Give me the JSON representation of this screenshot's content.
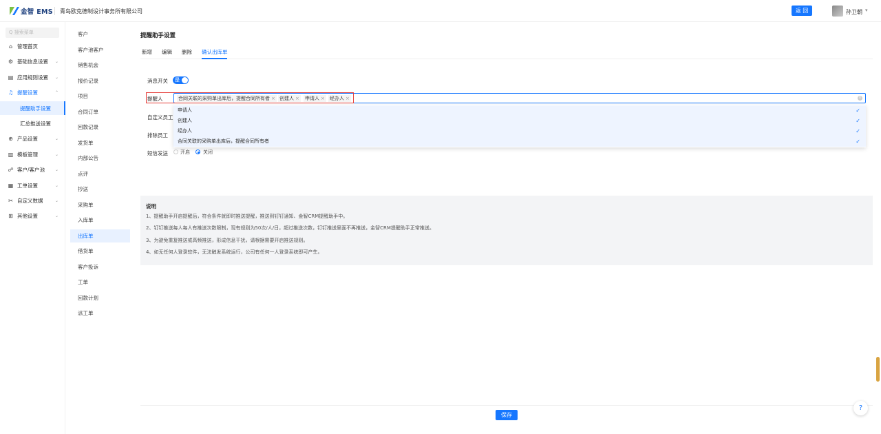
{
  "header": {
    "logo_text": "金智 EMS",
    "company": "青岛欧克德制设计事务所有限公司",
    "back_label": "返 回",
    "user_name": "孙卫朝",
    "user_caret": "▾"
  },
  "sidebar": {
    "search_placeholder": "Q 搜索菜单",
    "items": [
      {
        "icon": "⌂",
        "label": "管理首页"
      },
      {
        "icon": "⚙",
        "label": "基础信息设置",
        "chevron": "⌄"
      },
      {
        "icon": "▤",
        "label": "应用规则设置",
        "chevron": "⌄"
      },
      {
        "icon": "♫",
        "label": "提醒设置",
        "chevron": "⌃"
      },
      {
        "icon": "⊕",
        "label": "产品设置",
        "chevron": "⌄"
      },
      {
        "icon": "▥",
        "label": "模板管理",
        "chevron": "⌄"
      },
      {
        "icon": "☍",
        "label": "客户/客户池",
        "chevron": "⌄"
      },
      {
        "icon": "▦",
        "label": "工单设置",
        "chevron": "⌄"
      },
      {
        "icon": "✂",
        "label": "自定义数据",
        "chevron": "⌄"
      },
      {
        "icon": "⊞",
        "label": "其他设置",
        "chevron": "⌄"
      }
    ],
    "sub_items": [
      {
        "label": "提醒助手设置"
      },
      {
        "label": "汇总推送设置"
      }
    ]
  },
  "modules": [
    "客户",
    "客户池客户",
    "销售机会",
    "报价记录",
    "项目",
    "合同订单",
    "回款记录",
    "发货单",
    "内部公告",
    "点评",
    "抄送",
    "采购单",
    "入库单",
    "出库单",
    "借货单",
    "客户投诉",
    "工单",
    "回款计划",
    "派工单"
  ],
  "main": {
    "title": "提醒助手设置",
    "tabs": [
      "新增",
      "编辑",
      "删除",
      "确认出库单"
    ],
    "form": {
      "switch_label": "消息开关",
      "switch_text": "是",
      "reminder_label": "提醒人",
      "custom_label": "自定义员工",
      "exclude_label": "排除员工",
      "sms_label": "短信发送",
      "tags": [
        "合同关联的采购单出库后，提醒合同所有者",
        "创建人",
        "申请人",
        "经办人"
      ],
      "tag_remove": "×",
      "clear_icon": "×",
      "options": [
        "申请人",
        "创建人",
        "经办人",
        "合同关联的采购单出库后，提醒合同所有者"
      ],
      "check": "✓",
      "sms_on": "开启",
      "sms_off": "关闭"
    },
    "note": {
      "title": "说明",
      "lines": [
        "1、提醒助手开启提醒后，符合条件就即时推送提醒，推送到钉钉通知、金智CRM提醒助手中。",
        "2、钉钉推送每人每人有推送次数限制，现有规则为50次/人/日，超过推送次数，钉钉推送里面不再推送，金智CRM提醒助手正常推送。",
        "3、为避免重复推送或高频推送，形成信息干扰，请根据需要开启推送规则。",
        "4、如无任何人登录软件，无法触发系统运行，公司有任何一人登录系统即可产生。"
      ]
    },
    "save_label": "保存",
    "help_label": "?"
  }
}
